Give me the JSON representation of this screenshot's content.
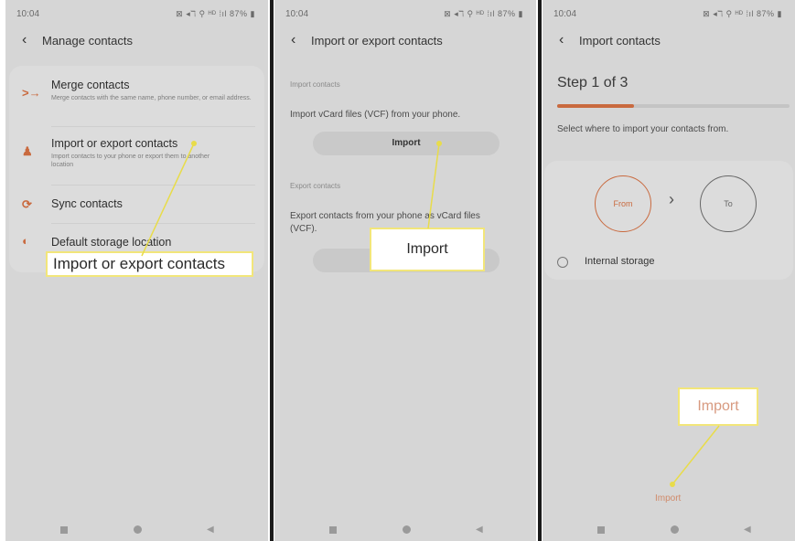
{
  "status": {
    "time": "10:04",
    "icons": "⊠ ◂ℸ ⚲ ᴴᴰ ⁞ıl",
    "battery": "87%"
  },
  "panel1": {
    "title": "Manage contacts",
    "items": [
      {
        "title": "Merge contacts",
        "subtitle": "Merge contacts with the same name, phone number, or email address."
      },
      {
        "title": "Import or export contacts",
        "subtitle": "Import contacts to your phone or export them to another location"
      },
      {
        "title": "Sync contacts",
        "subtitle": ""
      },
      {
        "title": "Default storage location",
        "subtitle": ""
      }
    ],
    "callout": "Import or export contacts"
  },
  "panel2": {
    "title": "Import or export contacts",
    "import_section": "Import contacts",
    "import_text": "Import vCard files (VCF) from your phone.",
    "import_button": "Import",
    "export_section": "Export contacts",
    "export_text": "Export contacts from your phone as vCard files (VCF).",
    "callout": "Import"
  },
  "panel3": {
    "title": "Import contacts",
    "step": "Step 1 of 3",
    "progress": 0.33,
    "instruction": "Select where to import your contacts from.",
    "from": "From",
    "to": "To",
    "storage_option": "Internal storage",
    "bottom_button": "Import",
    "callout": "Import"
  },
  "colors": {
    "accent": "#c96a3f",
    "callout_border": "#f2e67a",
    "callout_line": "#e8dc4a"
  }
}
